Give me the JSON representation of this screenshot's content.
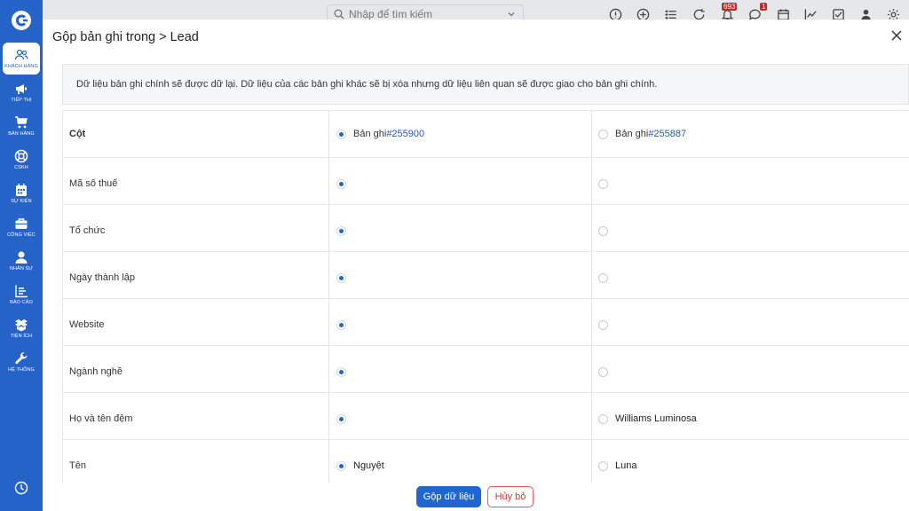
{
  "sidebar": {
    "items": [
      {
        "label": "KHÁCH HÀNG",
        "icon": "users-icon",
        "active": true
      },
      {
        "label": "TIẾP THỊ",
        "icon": "megaphone-icon"
      },
      {
        "label": "BÁN HÀNG",
        "icon": "cart-icon"
      },
      {
        "label": "CSKH",
        "icon": "support-icon"
      },
      {
        "label": "SỰ KIỆN",
        "icon": "calendar-icon"
      },
      {
        "label": "CÔNG VIỆC",
        "icon": "briefcase-icon"
      },
      {
        "label": "NHÂN SỰ",
        "icon": "person-icon"
      },
      {
        "label": "BÁO CÁO",
        "icon": "report-icon"
      },
      {
        "label": "TIỆN ÍCH",
        "icon": "box-icon"
      },
      {
        "label": "HỆ THỐNG",
        "icon": "wrench-icon"
      }
    ]
  },
  "topbar": {
    "search_placeholder": "Nhập để tìm kiếm",
    "notification_count": "693",
    "chat_count": "1"
  },
  "modal": {
    "title": "Gộp bản ghi trong > Lead",
    "notice": "Dữ liệu bản ghi chính sẽ được dữ lại. Dữ liệu của các bản ghi khác sẽ bị xóa nhưng dữ liệu liên quan sẽ được giao cho bản ghi chính.",
    "column_header": "Cột",
    "record1": {
      "prefix": "Bản ghi",
      "id": "#255900"
    },
    "record2": {
      "prefix": "Bản ghi",
      "id": "#255887"
    },
    "rows": [
      {
        "field": "Mã số thuế",
        "value1": "",
        "value2": ""
      },
      {
        "field": "Tổ chức",
        "value1": "",
        "value2": ""
      },
      {
        "field": "Ngày thành lập",
        "value1": "",
        "value2": ""
      },
      {
        "field": "Website",
        "value1": "",
        "value2": ""
      },
      {
        "field": "Ngành nghề",
        "value1": "",
        "value2": ""
      },
      {
        "field": "Họ và tên đệm",
        "value1": "",
        "value2": "Williams Luminosa"
      },
      {
        "field": "Tên",
        "value1": "Nguyệt",
        "value2": "Luna"
      }
    ],
    "merge_button": "Gộp dữ liệu",
    "cancel_button": "Hủy bỏ"
  },
  "colors": {
    "primary": "#1f66d1",
    "sidebar": "#2563c9",
    "danger": "#d0342c"
  }
}
